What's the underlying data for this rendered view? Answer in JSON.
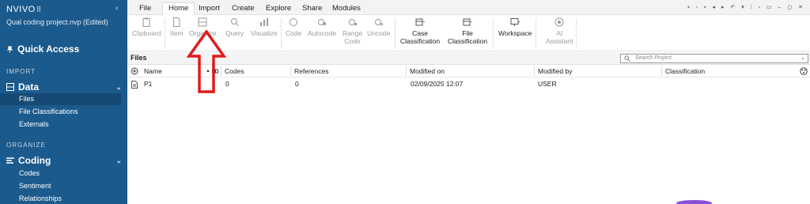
{
  "app": {
    "brand": "NVIVO",
    "project_title": "Qual coding project.nvp (Edited)"
  },
  "sidebar": {
    "quick_access": "Quick Access",
    "section_import": "IMPORT",
    "data_group": "Data",
    "data_items": [
      "Files",
      "File Classifications",
      "Externals"
    ],
    "section_organize": "ORGANIZE",
    "coding_group": "Coding",
    "coding_items": [
      "Codes",
      "Sentiment",
      "Relationships"
    ],
    "active_item": "Files"
  },
  "menu": {
    "tabs": [
      "File",
      "Home",
      "Import",
      "Create",
      "Explore",
      "Share",
      "Modules"
    ],
    "active": "Home"
  },
  "ribbon": {
    "buttons": [
      {
        "label": "Clipboard",
        "icon": "clipboard-icon",
        "enabled": false
      },
      {
        "label": "Item",
        "icon": "item-icon",
        "enabled": false
      },
      {
        "label": "Organize",
        "icon": "organize-icon",
        "enabled": false
      },
      {
        "label": "Query",
        "icon": "query-icon",
        "enabled": false
      },
      {
        "label": "Visualize",
        "icon": "visualize-icon",
        "enabled": false
      },
      {
        "label": "Code",
        "icon": "code-icon",
        "enabled": false
      },
      {
        "label": "Autocode",
        "icon": "autocode-icon",
        "enabled": false
      },
      {
        "label": "Range\nCode",
        "icon": "range-code-icon",
        "enabled": false
      },
      {
        "label": "Uncode",
        "icon": "uncode-icon",
        "enabled": false
      },
      {
        "label": "Case\nClassification",
        "icon": "case-classification-icon",
        "enabled": true
      },
      {
        "label": "File\nClassification",
        "icon": "file-classification-icon",
        "enabled": true
      },
      {
        "label": "Workspace",
        "icon": "workspace-icon",
        "enabled": true
      },
      {
        "label": "AI\nAssistant",
        "icon": "ai-assistant-icon",
        "enabled": false
      }
    ]
  },
  "files": {
    "title": "Files",
    "search_placeholder": "Search Project",
    "columns": [
      "Name",
      "Codes",
      "References",
      "Modified on",
      "Modified by",
      "Classification"
    ],
    "rows": [
      {
        "name": "P1",
        "codes": "0",
        "references": "0",
        "modified_on": "02/09/2025 12:07",
        "modified_by": "USER",
        "classification": ""
      }
    ]
  },
  "colors": {
    "sidebar_bg": "#1b5a8c",
    "annotation_arrow": "#e01b1b"
  }
}
